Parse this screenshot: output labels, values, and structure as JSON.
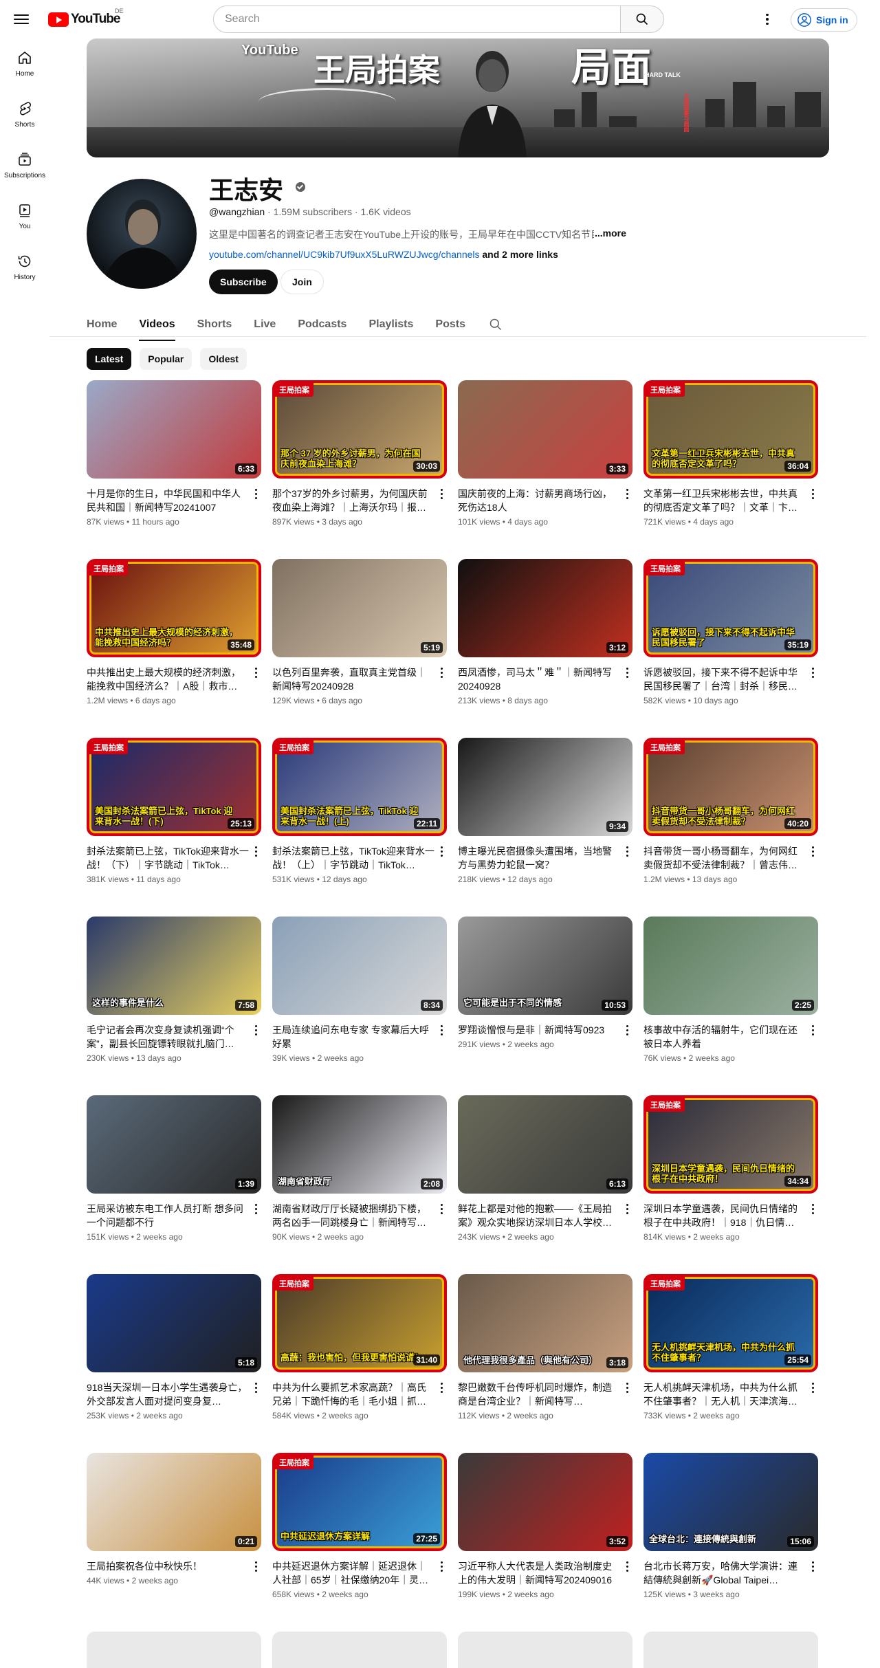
{
  "topbar": {
    "logo_text": "YouTube",
    "region": "DE",
    "search_placeholder": "Search",
    "signin_label": "Sign in"
  },
  "sidenav": [
    {
      "label": "Home",
      "icon": "home-icon"
    },
    {
      "label": "Shorts",
      "icon": "shorts-icon"
    },
    {
      "label": "Subscriptions",
      "icon": "subscriptions-icon"
    },
    {
      "label": "You",
      "icon": "you-icon"
    },
    {
      "label": "History",
      "icon": "history-icon"
    }
  ],
  "banner": {
    "yt_text": "YouTube",
    "title_left": "王局拍案",
    "title_right": "局面",
    "hard_talk": "HARD TALK",
    "side_text": "王局拍案与局面"
  },
  "channel": {
    "name": "王志安",
    "handle": "@wangzhian",
    "subscribers": "1.59M subscribers",
    "videos": "1.6K videos",
    "description": "这里是中国著名的调查记者王志安在YouTube上开设的账号，王局早年在中国CCTV知名节目",
    "more_label": "...more",
    "link": "youtube.com/channel/UC9kib7Uf9uxX5LuRWZUJwcg/channels",
    "more_links": "and 2 more links",
    "subscribe_label": "Subscribe",
    "join_label": "Join"
  },
  "tabs": [
    "Home",
    "Videos",
    "Shorts",
    "Live",
    "Podcasts",
    "Playlists",
    "Posts"
  ],
  "active_tab": "Videos",
  "chips": [
    "Latest",
    "Popular",
    "Oldest"
  ],
  "selected_chip": "Latest",
  "videos": [
    {
      "title": "十月是你的生日，中华民国和中华人民共和国｜新闻特写20241007",
      "views": "87K views",
      "age": "11 hours ago",
      "duration": "6:33",
      "tag": "",
      "caption": ""
    },
    {
      "title": "那个37岁的外乡讨薪男，为何国庆前夜血染上海滩？｜上海沃尔玛｜报…",
      "views": "897K views",
      "age": "3 days ago",
      "duration": "30:03",
      "tag": "王局拍案",
      "caption": "那个 37 岁的外乡讨薪男，为何在国庆前夜血染上海滩？"
    },
    {
      "title": "国庆前夜的上海：讨薪男商场行凶，死伤达18人",
      "views": "101K views",
      "age": "4 days ago",
      "duration": "3:33",
      "tag": "",
      "caption": ""
    },
    {
      "title": "文革第一红卫兵宋彬彬去世，中共真的彻底否定文革了吗？｜文革｜卞…",
      "views": "721K views",
      "age": "4 days ago",
      "duration": "36:04",
      "tag": "王局拍案",
      "caption": "文革第一红卫兵宋彬彬去世，中共真的彻底否定文革了吗？"
    },
    {
      "title": "中共推出史上最大规模的经济刺激，能挽救中国经济么？｜A股｜救市…",
      "views": "1.2M views",
      "age": "6 days ago",
      "duration": "35:48",
      "tag": "王局拍案",
      "caption": "中共推出史上最大规模的经济刺激，能挽救中国经济吗？"
    },
    {
      "title": "以色列百里奔袭，直取真主党首级｜新闻特写20240928",
      "views": "129K views",
      "age": "6 days ago",
      "duration": "5:19",
      "tag": "",
      "caption": ""
    },
    {
      "title": "西凤酒惨，司马太＂难＂｜新闻特写20240928",
      "views": "213K views",
      "age": "8 days ago",
      "duration": "3:12",
      "tag": "",
      "caption": ""
    },
    {
      "title": "诉愿被驳回，接下来不得不起诉中华民国移民署了｜台湾｜封杀｜移民…",
      "views": "582K views",
      "age": "10 days ago",
      "duration": "35:19",
      "tag": "王局拍案",
      "caption": "诉愿被驳回，接下来不得不起诉中华民国移民署了"
    },
    {
      "title": "封杀法案箭已上弦，TikTok迎来背水一战！（下）｜字节跳动｜TikTok…",
      "views": "381K views",
      "age": "11 days ago",
      "duration": "25:13",
      "tag": "王局拍案",
      "caption": "美国封杀法案箭已上弦，TikTok 迎来背水一战！(下)"
    },
    {
      "title": "封杀法案箭已上弦，TikTok迎来背水一战！（上）｜字节跳动｜TikTok…",
      "views": "531K views",
      "age": "12 days ago",
      "duration": "22:11",
      "tag": "王局拍案",
      "caption": "美国封杀法案箭已上弦，TikTok 迎来背水一战！(上)"
    },
    {
      "title": "博主曝光民宿摄像头遭围堵，当地警方与黑势力蛇鼠一窝？",
      "views": "218K views",
      "age": "12 days ago",
      "duration": "9:34",
      "tag": "",
      "caption": ""
    },
    {
      "title": "抖音带货一哥小杨哥翻车，为何网红卖假货却不受法律制裁？｜曾志伟…",
      "views": "1.2M views",
      "age": "13 days ago",
      "duration": "40:20",
      "tag": "王局拍案",
      "caption": "抖音带货一哥小杨哥翻车，为何网红卖假货却不受法律制裁？"
    },
    {
      "title": "毛宁记者会再次变身复读机强调“个案”，副县长回旋镖转眼就扎脑门…",
      "views": "230K views",
      "age": "13 days ago",
      "duration": "7:58",
      "tag": "",
      "caption": "这样的事件是什么"
    },
    {
      "title": "王局连续追问东电专家 专家幕后大呼好累",
      "views": "39K views",
      "age": "2 weeks ago",
      "duration": "8:34",
      "tag": "",
      "caption": ""
    },
    {
      "title": "罗翔谈憎恨与是非｜新闻特写0923",
      "views": "291K views",
      "age": "2 weeks ago",
      "duration": "10:53",
      "tag": "",
      "caption": "它可能是出于不同的情感"
    },
    {
      "title": "核事故中存活的辐射牛，它们现在还被日本人养着",
      "views": "76K views",
      "age": "2 weeks ago",
      "duration": "2:25",
      "tag": "",
      "caption": ""
    },
    {
      "title": "王局采访被东电工作人员打断 想多问一个问题都不行",
      "views": "151K views",
      "age": "2 weeks ago",
      "duration": "1:39",
      "tag": "",
      "caption": ""
    },
    {
      "title": "湖南省财政厅厅长疑被捆绑扔下楼，两名凶手一同跳楼身亡｜新闻特写…",
      "views": "90K views",
      "age": "2 weeks ago",
      "duration": "2:08",
      "tag": "",
      "caption": "湖南省财政厅"
    },
    {
      "title": "鲜花上都是对他的抱歉——《王局拍案》观众实地探访深圳日本人学校…",
      "views": "243K views",
      "age": "2 weeks ago",
      "duration": "6:13",
      "tag": "",
      "caption": ""
    },
    {
      "title": "深圳日本学童遇袭，民间仇日情绪的根子在中共政府！｜918｜仇日情…",
      "views": "814K views",
      "age": "2 weeks ago",
      "duration": "34:34",
      "tag": "王局拍案",
      "caption": "深圳日本学童遇袭，民间仇日情绪的根子在中共政府！"
    },
    {
      "title": "918当天深圳一日本小学生遇袭身亡，外交部发言人面对提问变身复…",
      "views": "253K views",
      "age": "2 weeks ago",
      "duration": "5:18",
      "tag": "",
      "caption": ""
    },
    {
      "title": "中共为什么要抓艺术家高蔬？｜高氏兄弟｜下跪忏悔的毛｜毛小姐｜抓…",
      "views": "584K views",
      "age": "2 weeks ago",
      "duration": "31:40",
      "tag": "王局拍案",
      "caption": "高蔬：我也害怕，但我更害怕说谎！"
    },
    {
      "title": "黎巴嫩数千台传呼机同时爆炸，制造商是台湾企业？｜新闻特写…",
      "views": "112K views",
      "age": "2 weeks ago",
      "duration": "3:18",
      "tag": "",
      "caption": "他代理我很多產品（與他有公司）"
    },
    {
      "title": "无人机挑衅天津机场，中共为什么抓不住肇事者？｜无人机｜天津滨海…",
      "views": "733K views",
      "age": "2 weeks ago",
      "duration": "25:54",
      "tag": "王局拍案",
      "caption": "无人机挑衅天津机场，中共为什么抓不住肇事者？"
    },
    {
      "title": "王局拍案祝各位中秋快乐！",
      "views": "44K views",
      "age": "2 weeks ago",
      "duration": "0:21",
      "tag": "",
      "caption": ""
    },
    {
      "title": "中共延迟退休方案详解｜延迟退休｜人社部｜65岁｜社保缴纳20年｜灵…",
      "views": "658K views",
      "age": "2 weeks ago",
      "duration": "27:25",
      "tag": "王局拍案",
      "caption": "中共延迟退休方案详解"
    },
    {
      "title": "习近平称人大代表是人类政治制度史上的伟大发明｜新闻特写202409016",
      "views": "199K views",
      "age": "2 weeks ago",
      "duration": "3:52",
      "tag": "",
      "caption": ""
    },
    {
      "title": "台北市长蒋万安，哈佛大学演讲：連結傳統與創新🚀Global Taipei…",
      "views": "125K views",
      "age": "3 weeks ago",
      "duration": "15:06",
      "tag": "",
      "caption": "全球台北：連接傳統與創新"
    }
  ],
  "colors": {
    "brand_red": "#ff0000",
    "link_blue": "#065fd4",
    "tag_red": "#d4000f",
    "caption_yellow": "#ffe600"
  }
}
